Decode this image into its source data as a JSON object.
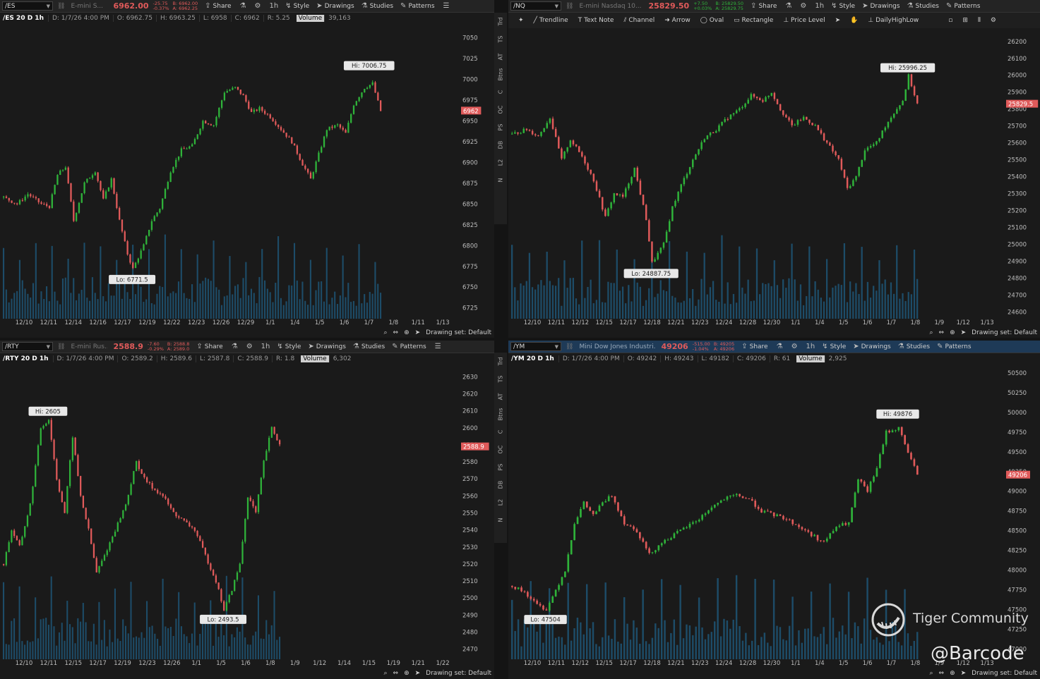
{
  "colors": {
    "up": "#2fb33a",
    "down": "#e05a5a",
    "volume": "#1f5677",
    "axis": "#bdbdbd",
    "bg": "#1a1a1a"
  },
  "icons": [
    "share-icon",
    "flask-icon",
    "gear-icon",
    "style-icon",
    "cursor-icon",
    "studies-icon",
    "patterns-icon",
    "menu-icon",
    "zoom-icon",
    "pan-icon",
    "crosshair-icon"
  ],
  "common": {
    "share": "Share",
    "timeframe": "1h",
    "style": "Style",
    "drawings": "Drawings",
    "studies": "Studies",
    "patterns": "Patterns",
    "drawing_set": "Drawing set: Default"
  },
  "draw_toolbar": {
    "trendline": "Trendline",
    "text_note": "Text Note",
    "channel": "Channel",
    "arrow": "Arrow",
    "oval": "Oval",
    "rectangle": "Rectangle",
    "price_level": "Price Level",
    "daily": "DailyHighLow"
  },
  "side_tabs": [
    "Trd",
    "TS",
    "AT",
    "Btns",
    "C",
    "OC",
    "PS",
    "DB",
    "L2",
    "N"
  ],
  "panels": [
    {
      "symbol": "/ES",
      "desc": "E-mini S...",
      "price": "6962.00",
      "change": "-25.75",
      "pct": "-0.37%",
      "bid": "B: 6962.00",
      "ask": "A: 6962.25",
      "title": "/ES 20 D 1h",
      "date": "D: 1/7/26 4:00 PM",
      "open": "O: 6962.75",
      "high": "H: 6963.25",
      "low": "L: 6958",
      "close": "C: 6962",
      "range": "R: 5.25",
      "volume_label": "Volume",
      "volume": "39,163",
      "hi_label": "Hi: 7006.75",
      "lo_label": "Lo: 6771.5",
      "price_tag": "6962"
    },
    {
      "symbol": "/NQ",
      "desc": "E-mini Nasdaq 10...",
      "price": "25829.50",
      "change": "+7.50",
      "pct": "+0.03%",
      "bid": "B: 25829.50",
      "ask": "A: 25829.75",
      "hi_label": "Hi: 25996.25",
      "lo_label": "Lo: 24887.75",
      "price_tag": "25829.5"
    },
    {
      "symbol": "/RTY",
      "desc": "E-mini Rus...",
      "price": "2588.9",
      "change": "-7.60",
      "pct": "-0.29%",
      "bid": "B: 2588.8",
      "ask": "A: 2589.0",
      "title": "/RTY 20 D 1h",
      "date": "D: 1/7/26 4:00 PM",
      "open": "O: 2589.2",
      "high": "H: 2589.6",
      "low": "L: 2587.8",
      "close": "C: 2588.9",
      "range": "R: 1.8",
      "volume_label": "Volume",
      "volume": "6,302",
      "hi_label": "Hi: 2605",
      "lo_label": "Lo: 2493.5",
      "price_tag": "2588.9"
    },
    {
      "symbol": "/YM",
      "desc": "Mini Dow Jones Industri...",
      "price": "49206",
      "change": "-515.00",
      "pct": "-1.04%",
      "bid": "B: 49205",
      "ask": "A: 49206",
      "title": "/YM 20 D 1h",
      "date": "D: 1/7/26 4:00 PM",
      "open": "O: 49242",
      "high": "H: 49243",
      "low": "L: 49182",
      "close": "C: 49206",
      "range": "R: 61",
      "volume_label": "Volume",
      "volume": "2,925",
      "hi_label": "Hi: 49876",
      "lo_label": "Lo: 47504",
      "price_tag": "49206"
    }
  ],
  "chart_data": [
    {
      "type": "candlestick",
      "symbol": "/ES",
      "yticks": [
        6725,
        6750,
        6775,
        6800,
        6825,
        6850,
        6875,
        6900,
        6925,
        6950,
        6975,
        7000,
        7025,
        7050
      ],
      "ylim": [
        6712,
        7065
      ],
      "xticks": [
        "12/10",
        "12/11",
        "12/14",
        "12/16",
        "12/17",
        "12/19",
        "12/22",
        "12/23",
        "12/26",
        "12/29",
        "1/1",
        "1/4",
        "1/5",
        "1/6",
        "1/7",
        "1/8",
        "1/11",
        "1/13"
      ],
      "path": [
        [
          0,
          6858
        ],
        [
          5,
          6850
        ],
        [
          9,
          6862
        ],
        [
          14,
          6850
        ],
        [
          17,
          6847
        ],
        [
          20,
          6885
        ],
        [
          23,
          6895
        ],
        [
          26,
          6830
        ],
        [
          30,
          6875
        ],
        [
          34,
          6890
        ],
        [
          37,
          6855
        ],
        [
          40,
          6880
        ],
        [
          43,
          6830
        ],
        [
          46,
          6790
        ],
        [
          48,
          6772
        ],
        [
          52,
          6800
        ],
        [
          55,
          6830
        ],
        [
          58,
          6845
        ],
        [
          62,
          6890
        ],
        [
          66,
          6915
        ],
        [
          70,
          6920
        ],
        [
          74,
          6950
        ],
        [
          78,
          6945
        ],
        [
          82,
          6985
        ],
        [
          86,
          6990
        ],
        [
          89,
          6980
        ],
        [
          92,
          6960
        ],
        [
          95,
          6965
        ],
        [
          99,
          6955
        ],
        [
          103,
          6940
        ],
        [
          107,
          6925
        ],
        [
          111,
          6898
        ],
        [
          114,
          6880
        ],
        [
          117,
          6910
        ],
        [
          120,
          6940
        ],
        [
          124,
          6945
        ],
        [
          127,
          6935
        ],
        [
          130,
          6970
        ],
        [
          134,
          6990
        ],
        [
          137,
          6995
        ],
        [
          140,
          6962
        ]
      ],
      "hi": {
        "i": 136,
        "v": 7006.75
      },
      "lo": {
        "i": 48,
        "v": 6771.5
      },
      "last": 6962
    },
    {
      "type": "candlestick",
      "symbol": "/NQ",
      "yticks": [
        24600,
        24700,
        24800,
        24900,
        25000,
        25100,
        25200,
        25300,
        25400,
        25500,
        25600,
        25700,
        25800,
        25900,
        26000,
        26100,
        26200
      ],
      "ylim": [
        24560,
        26270
      ],
      "xticks": [
        "12/10",
        "12/11",
        "12/12",
        "12/15",
        "12/17",
        "12/18",
        "12/21",
        "12/23",
        "12/24",
        "12/28",
        "12/30",
        "1/1",
        "1/4",
        "1/5",
        "1/6",
        "1/7",
        "1/8",
        "1/9",
        "1/12",
        "1/13"
      ],
      "path": [
        [
          0,
          25650
        ],
        [
          5,
          25680
        ],
        [
          9,
          25640
        ],
        [
          13,
          25750
        ],
        [
          17,
          25500
        ],
        [
          20,
          25620
        ],
        [
          24,
          25520
        ],
        [
          28,
          25380
        ],
        [
          32,
          25160
        ],
        [
          35,
          25300
        ],
        [
          38,
          25280
        ],
        [
          42,
          25450
        ],
        [
          46,
          25150
        ],
        [
          48,
          24890
        ],
        [
          52,
          25000
        ],
        [
          55,
          25220
        ],
        [
          58,
          25350
        ],
        [
          62,
          25500
        ],
        [
          66,
          25630
        ],
        [
          70,
          25680
        ],
        [
          74,
          25750
        ],
        [
          78,
          25800
        ],
        [
          82,
          25880
        ],
        [
          86,
          25850
        ],
        [
          89,
          25900
        ],
        [
          92,
          25800
        ],
        [
          96,
          25700
        ],
        [
          100,
          25750
        ],
        [
          104,
          25700
        ],
        [
          108,
          25600
        ],
        [
          112,
          25500
        ],
        [
          115,
          25330
        ],
        [
          118,
          25400
        ],
        [
          121,
          25560
        ],
        [
          125,
          25600
        ],
        [
          128,
          25700
        ],
        [
          131,
          25780
        ],
        [
          134,
          25850
        ],
        [
          136,
          25996
        ],
        [
          139,
          25830
        ]
      ],
      "hi": {
        "i": 136,
        "v": 25996.25
      },
      "lo": {
        "i": 48,
        "v": 24887.75
      },
      "last": 25829.5
    },
    {
      "type": "candlestick",
      "symbol": "/RTY",
      "yticks": [
        2470,
        2480,
        2490,
        2500,
        2510,
        2520,
        2530,
        2540,
        2550,
        2560,
        2570,
        2580,
        2590,
        2600,
        2610,
        2620,
        2630
      ],
      "ylim": [
        2464,
        2636
      ],
      "xticks": [
        "12/10",
        "12/11",
        "12/15",
        "12/17",
        "12/19",
        "12/23",
        "12/26",
        "1/1",
        "1/5",
        "1/6",
        "1/8",
        "1/9",
        "1/12",
        "1/14",
        "1/15",
        "1/19",
        "1/21",
        "1/22"
      ],
      "path": [
        [
          0,
          2520
        ],
        [
          3,
          2540
        ],
        [
          6,
          2530
        ],
        [
          10,
          2555
        ],
        [
          14,
          2600
        ],
        [
          17,
          2605
        ],
        [
          20,
          2570
        ],
        [
          23,
          2550
        ],
        [
          26,
          2595
        ],
        [
          29,
          2560
        ],
        [
          32,
          2540
        ],
        [
          35,
          2515
        ],
        [
          38,
          2525
        ],
        [
          42,
          2540
        ],
        [
          46,
          2555
        ],
        [
          50,
          2580
        ],
        [
          53,
          2570
        ],
        [
          56,
          2565
        ],
        [
          60,
          2560
        ],
        [
          64,
          2550
        ],
        [
          68,
          2545
        ],
        [
          72,
          2540
        ],
        [
          76,
          2525
        ],
        [
          80,
          2510
        ],
        [
          83,
          2493
        ],
        [
          86,
          2505
        ],
        [
          89,
          2520
        ],
        [
          92,
          2560
        ],
        [
          95,
          2550
        ],
        [
          98,
          2580
        ],
        [
          101,
          2600
        ],
        [
          104,
          2590
        ]
      ],
      "hi": {
        "i": 17,
        "v": 2605
      },
      "lo": {
        "i": 83,
        "v": 2493.5
      },
      "last": 2588.9
    },
    {
      "type": "candlestick",
      "symbol": "/YM",
      "yticks": [
        47000,
        47250,
        47500,
        47750,
        48000,
        48250,
        48500,
        48750,
        49000,
        49250,
        49500,
        49750,
        50000,
        50250,
        50500
      ],
      "ylim": [
        46870,
        50580
      ],
      "xticks": [
        "12/10",
        "12/11",
        "12/12",
        "12/15",
        "12/17",
        "12/18",
        "12/21",
        "12/23",
        "12/24",
        "12/28",
        "12/30",
        "1/1",
        "1/4",
        "1/5",
        "1/6",
        "1/7",
        "1/8",
        "1/9",
        "1/12",
        "1/13"
      ],
      "path": [
        [
          0,
          47800
        ],
        [
          4,
          47720
        ],
        [
          8,
          47560
        ],
        [
          11,
          47504
        ],
        [
          14,
          47750
        ],
        [
          17,
          48000
        ],
        [
          20,
          48600
        ],
        [
          23,
          48850
        ],
        [
          26,
          48700
        ],
        [
          29,
          48850
        ],
        [
          32,
          48950
        ],
        [
          36,
          48600
        ],
        [
          40,
          48500
        ],
        [
          44,
          48200
        ],
        [
          48,
          48350
        ],
        [
          52,
          48450
        ],
        [
          56,
          48550
        ],
        [
          60,
          48650
        ],
        [
          64,
          48800
        ],
        [
          68,
          48900
        ],
        [
          72,
          48950
        ],
        [
          76,
          48900
        ],
        [
          80,
          48750
        ],
        [
          84,
          48700
        ],
        [
          88,
          48650
        ],
        [
          92,
          48550
        ],
        [
          96,
          48450
        ],
        [
          100,
          48350
        ],
        [
          104,
          48550
        ],
        [
          108,
          48600
        ],
        [
          111,
          49150
        ],
        [
          114,
          49000
        ],
        [
          117,
          49300
        ],
        [
          120,
          49750
        ],
        [
          124,
          49800
        ],
        [
          127,
          49500
        ],
        [
          130,
          49206
        ]
      ],
      "hi": {
        "i": 124,
        "v": 49876
      },
      "lo": {
        "i": 11,
        "v": 47504
      },
      "last": 49206
    }
  ],
  "watermark": {
    "brand": "Tiger Community",
    "handle": "@Barcode"
  }
}
